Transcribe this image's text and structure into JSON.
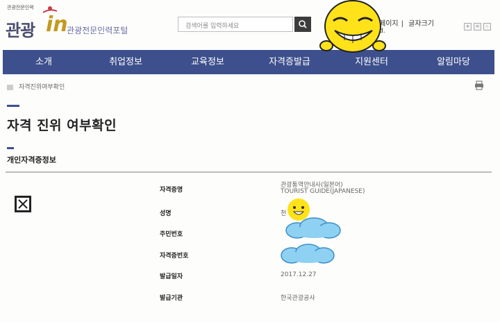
{
  "header": {
    "logo_small": "관광전문인력",
    "logo_main": "관광",
    "logo_in": "in",
    "portal_name": "관광전문인력포털",
    "search_placeholder": "검색어를 입력하세요",
    "util_links": [
      "페이지",
      "글자크기"
    ],
    "util_sub": "d.",
    "font_size_buttons": [
      "+",
      "=",
      "-"
    ]
  },
  "nav": {
    "items": [
      "소개",
      "취업정보",
      "교육정보",
      "자격증발급",
      "지원센터",
      "알림마당"
    ]
  },
  "breadcrumb": "자격진위여부확인",
  "page_title": "자격 진위 여부확인",
  "section_title": "개인자격증정보",
  "info": {
    "labels": {
      "cert": "자격증명",
      "name": "성명",
      "resident_no": "주민번호",
      "cert_no": "자격증번호",
      "issue_date": "발급일자",
      "issuer": "발급기관"
    },
    "values": {
      "cert_line1": "관광통역안내사(일본어)",
      "cert_line2": "TOURIST GUIDE(JAPANESE)",
      "name": "천",
      "resident_no": "",
      "cert_no": "",
      "issue_date": "2017.12.27",
      "issuer": "한국관광공사"
    }
  },
  "colors": {
    "nav_bg": "#3d4f8c",
    "accent_gold": "#c49a1e",
    "emoji_yellow": "#ffe21a",
    "cloud_blue": "#8ed1f2"
  }
}
